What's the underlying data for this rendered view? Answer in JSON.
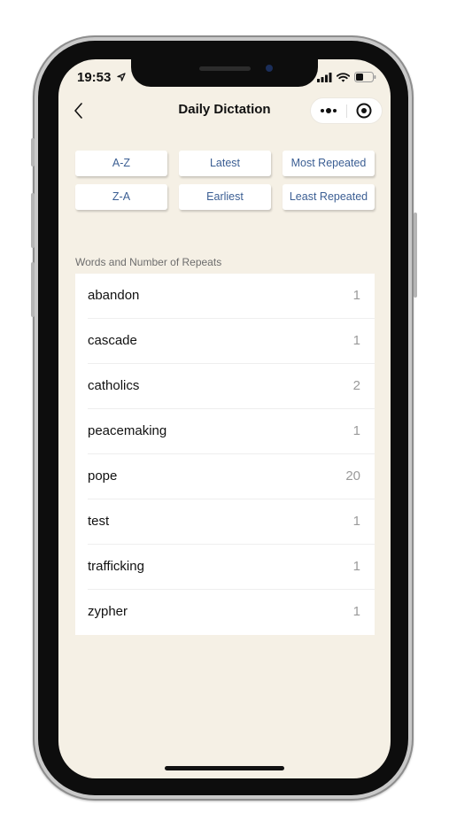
{
  "status_bar": {
    "time": "19:53"
  },
  "nav": {
    "title": "Daily Dictation"
  },
  "sort_buttons": [
    {
      "label": "A-Z"
    },
    {
      "label": "Latest"
    },
    {
      "label": "Most Repeated"
    },
    {
      "label": "Z-A"
    },
    {
      "label": "Earliest"
    },
    {
      "label": "Least Repeated"
    }
  ],
  "words_section": {
    "label": "Words and Number of Repeats",
    "items": [
      {
        "word": "abandon",
        "count": "1"
      },
      {
        "word": "cascade",
        "count": "1"
      },
      {
        "word": "catholics",
        "count": "2"
      },
      {
        "word": "peacemaking",
        "count": "1"
      },
      {
        "word": "pope",
        "count": "20"
      },
      {
        "word": "test",
        "count": "1"
      },
      {
        "word": "trafficking",
        "count": "1"
      },
      {
        "word": "zypher",
        "count": "1"
      }
    ]
  },
  "colors": {
    "background": "#f5f0e5",
    "button_text": "#3b5e93",
    "count_text": "#9a9a9a"
  },
  "icons": [
    "location-arrow-icon",
    "signal-icon",
    "wifi-icon",
    "battery-icon",
    "back-chevron-icon",
    "more-dots-icon",
    "target-icon"
  ]
}
